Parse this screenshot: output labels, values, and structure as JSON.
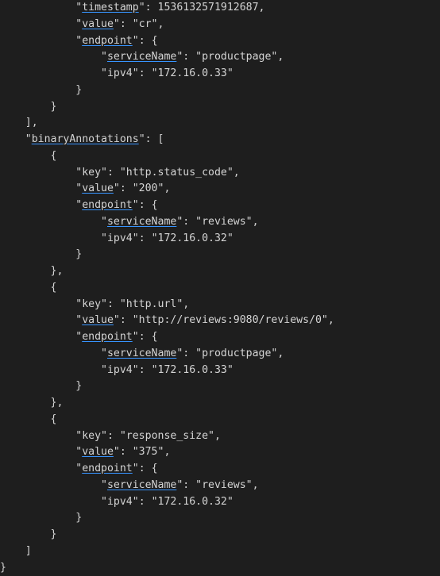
{
  "lines": [
    "            \"timestamp\": 1536132571912687,",
    "            \"value\": \"cr\",",
    "            \"endpoint\": {",
    "                \"serviceName\": \"productpage\",",
    "                \"ipv4\": \"172.16.0.33\"",
    "            }",
    "        }",
    "    ],",
    "    \"binaryAnnotations\": [",
    "        {",
    "            \"key\": \"http.status_code\",",
    "            \"value\": \"200\",",
    "            \"endpoint\": {",
    "                \"serviceName\": \"reviews\",",
    "                \"ipv4\": \"172.16.0.32\"",
    "            }",
    "        },",
    "        {",
    "            \"key\": \"http.url\",",
    "            \"value\": \"http://reviews:9080/reviews/0\",",
    "            \"endpoint\": {",
    "                \"serviceName\": \"productpage\",",
    "                \"ipv4\": \"172.16.0.33\"",
    "            }",
    "        },",
    "        {",
    "            \"key\": \"response_size\",",
    "            \"value\": \"375\",",
    "            \"endpoint\": {",
    "                \"serviceName\": \"reviews\",",
    "                \"ipv4\": \"172.16.0.32\"",
    "            }",
    "        }",
    "    ]",
    "}"
  ],
  "underlinedKeys": [
    "timestamp",
    "value",
    "endpoint",
    "serviceName",
    "binaryAnnotations"
  ],
  "json_data": {
    "annotations_partial_tail": {
      "timestamp": 1536132571912687,
      "value": "cr",
      "endpoint": {
        "serviceName": "productpage",
        "ipv4": "172.16.0.33"
      }
    },
    "binaryAnnotations": [
      {
        "key": "http.status_code",
        "value": "200",
        "endpoint": {
          "serviceName": "reviews",
          "ipv4": "172.16.0.32"
        }
      },
      {
        "key": "http.url",
        "value": "http://reviews:9080/reviews/0",
        "endpoint": {
          "serviceName": "productpage",
          "ipv4": "172.16.0.33"
        }
      },
      {
        "key": "response_size",
        "value": "375",
        "endpoint": {
          "serviceName": "reviews",
          "ipv4": "172.16.0.32"
        }
      }
    ]
  }
}
